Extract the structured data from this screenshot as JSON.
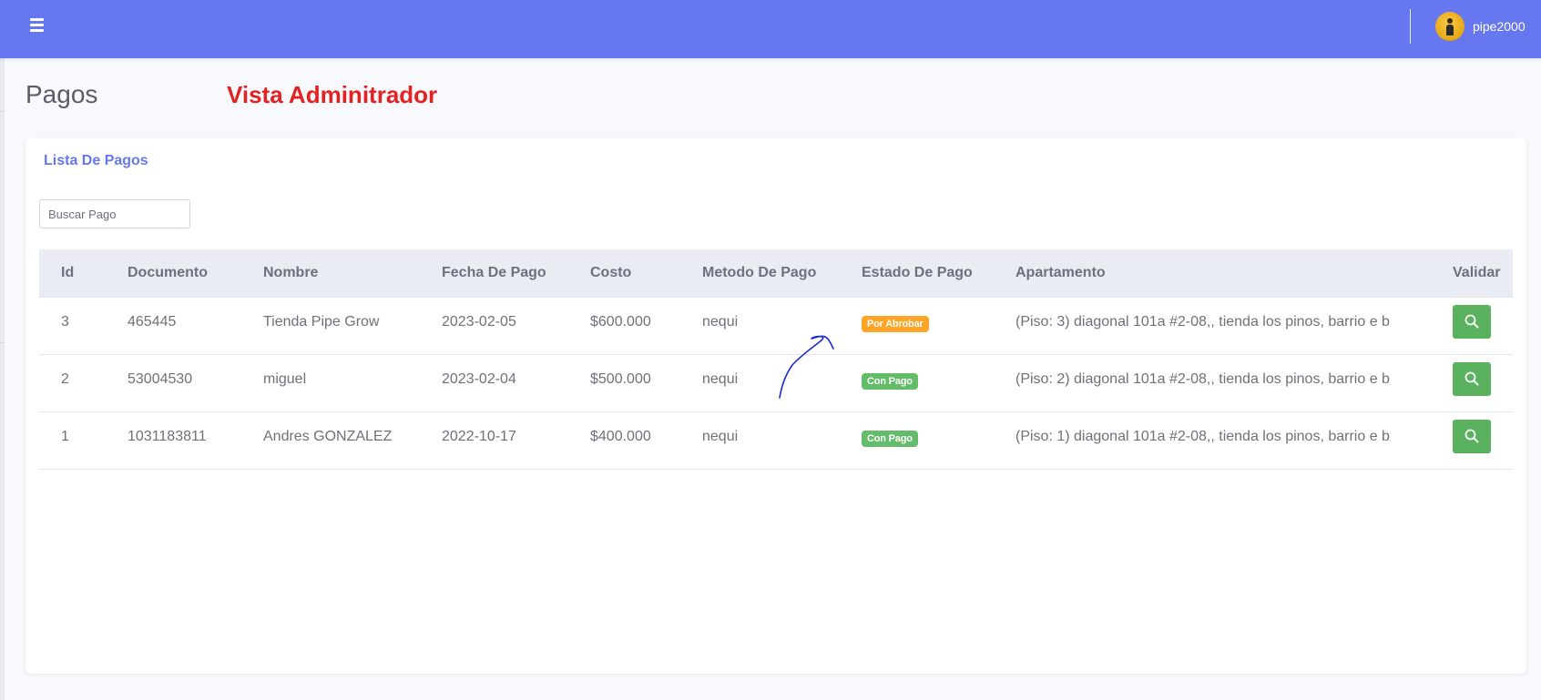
{
  "topbar": {
    "username": "pipe2000",
    "menu_icon": "hamburger-menu-icon"
  },
  "page": {
    "title": "Pagos",
    "admin_label": "Vista Adminitrador"
  },
  "card": {
    "title": "Lista De Pagos"
  },
  "search": {
    "placeholder": "Buscar Pago",
    "value": ""
  },
  "table": {
    "headers": [
      "Id",
      "Documento",
      "Nombre",
      "Fecha De Pago",
      "Costo",
      "Metodo De Pago",
      "Estado De Pago",
      "Apartamento",
      "Validar"
    ],
    "rows": [
      {
        "id": "3",
        "documento": "465445",
        "nombre": "Tienda Pipe Grow",
        "fecha": "2023-02-05",
        "costo": "$600.000",
        "metodo": "nequi",
        "estado": "Por Abrobar",
        "apartamento": "(Piso: 3) diagonal 101a #2-08,, tienda los pinos, barrio e b"
      },
      {
        "id": "2",
        "documento": "53004530",
        "nombre": "miguel",
        "fecha": "2023-02-04",
        "costo": "$500.000",
        "metodo": "nequi",
        "estado": "Con Pago",
        "apartamento": "(Piso: 2) diagonal 101a #2-08,, tienda los pinos, barrio e b"
      },
      {
        "id": "1",
        "documento": "1031183811",
        "nombre": "Andres GONZALEZ",
        "fecha": "2022-10-17",
        "costo": "$400.000",
        "metodo": "nequi",
        "estado": "Con Pago",
        "apartamento": "(Piso: 1) diagonal 101a #2-08,, tienda los pinos, barrio e b"
      }
    ]
  },
  "colors": {
    "topbar": "#6777ef",
    "admin_label": "#e52222",
    "badge_pending": "#ffa426",
    "badge_paid": "#63bc6a",
    "validate_button": "#5ab25f"
  }
}
